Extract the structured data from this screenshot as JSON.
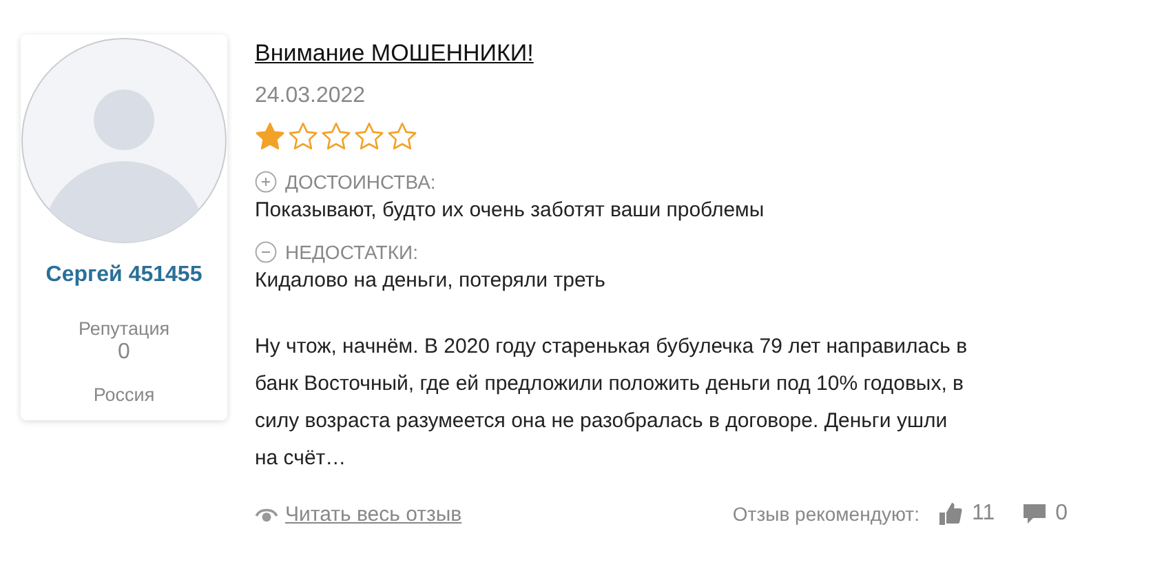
{
  "author": {
    "name": "Сергей 451455",
    "reputation_label": "Репутация",
    "reputation": "0",
    "country": "Россия"
  },
  "review": {
    "title": "Внимание МОШЕННИКИ!",
    "date": "24.03.2022",
    "stars": 1,
    "pros_label": "ДОСТОИНСТВА:",
    "pros": "Показывают, будто их очень заботят ваши проблемы",
    "cons_label": "НЕДОСТАТКИ:",
    "cons": "Кидалово на деньги, потеряли треть",
    "body": "Ну чтож, начнём. В 2020 году старенькая бубулечка 79 лет направилась в банк Восточный, где ей предложили положить деньги под 10% годовых, в силу возраста разумеется она не разобралась в договоре. Деньги ушли на счёт…",
    "read_more": "Читать весь отзыв",
    "recommend_label": "Отзыв рекомендуют:",
    "likes": "11",
    "comments": "0"
  }
}
